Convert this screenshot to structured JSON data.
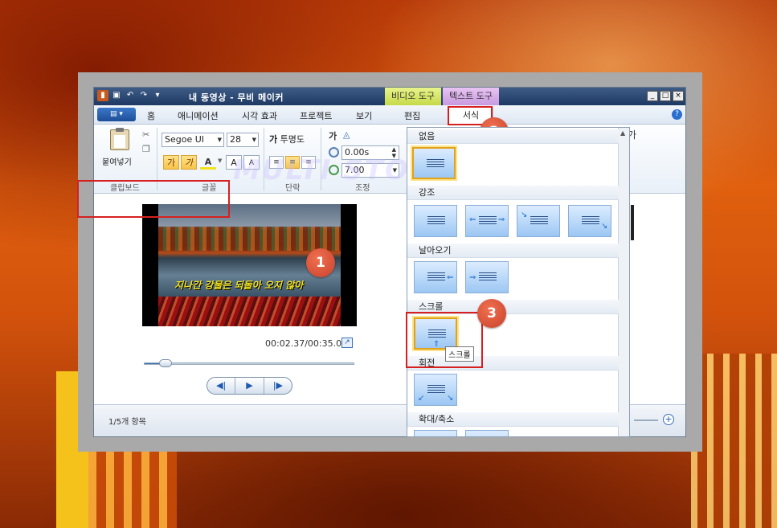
{
  "app": {
    "title": "내 동영상 - 무비 메이커",
    "context_tabs": {
      "video_tools": "비디오 도구",
      "text_tools": "텍스트 도구"
    },
    "window_buttons": {
      "minimize": "_",
      "maximize": "□",
      "close": "×"
    }
  },
  "tabs": {
    "file": "▤ ▾",
    "home": "홈",
    "animation": "애니메이션",
    "visual_effects": "시각 효과",
    "project": "프로젝트",
    "view": "보기",
    "edit": "편집",
    "format": "서식",
    "help": "?"
  },
  "ribbon": {
    "clipboard": {
      "paste": "붙여넣기",
      "label": "클립보드"
    },
    "font": {
      "family": "Segoe UI",
      "size": "28",
      "bold": "가",
      "italic": "가",
      "color": "A",
      "grow": "A",
      "shrink": "A",
      "label": "글꼴"
    },
    "paragraph": {
      "transparency": "투명도",
      "label": "단락"
    },
    "adjust": {
      "start_time": "0.00s",
      "duration": "7.00",
      "label": "조정"
    },
    "right_fragment": "가"
  },
  "preview": {
    "subtitle": "지나간 강물은 되돌아 오지 않아",
    "watermark": "MULTI STORY",
    "time": "00:02.37/00:35.00",
    "seek_fraction": 0.07,
    "controls": {
      "prev": "◀|",
      "play": "▶",
      "next": "|▶"
    }
  },
  "status": {
    "items": "1/5개 항목",
    "zoom_plus": "+"
  },
  "gallery": {
    "sections": {
      "none": "없음",
      "emphasis": "강조",
      "fly_in": "날아오기",
      "scroll": "스크롤",
      "rotate": "회전",
      "zoom": "확대/축소"
    },
    "tooltip": "스크롤"
  },
  "badges": {
    "one": "1",
    "two": "2",
    "three": "3"
  },
  "colors": {
    "accent_red": "#d62020",
    "badge": "#c8412c",
    "subtitle_yellow": "#f2e11c",
    "ribbon_blue": "#1d4e98"
  }
}
